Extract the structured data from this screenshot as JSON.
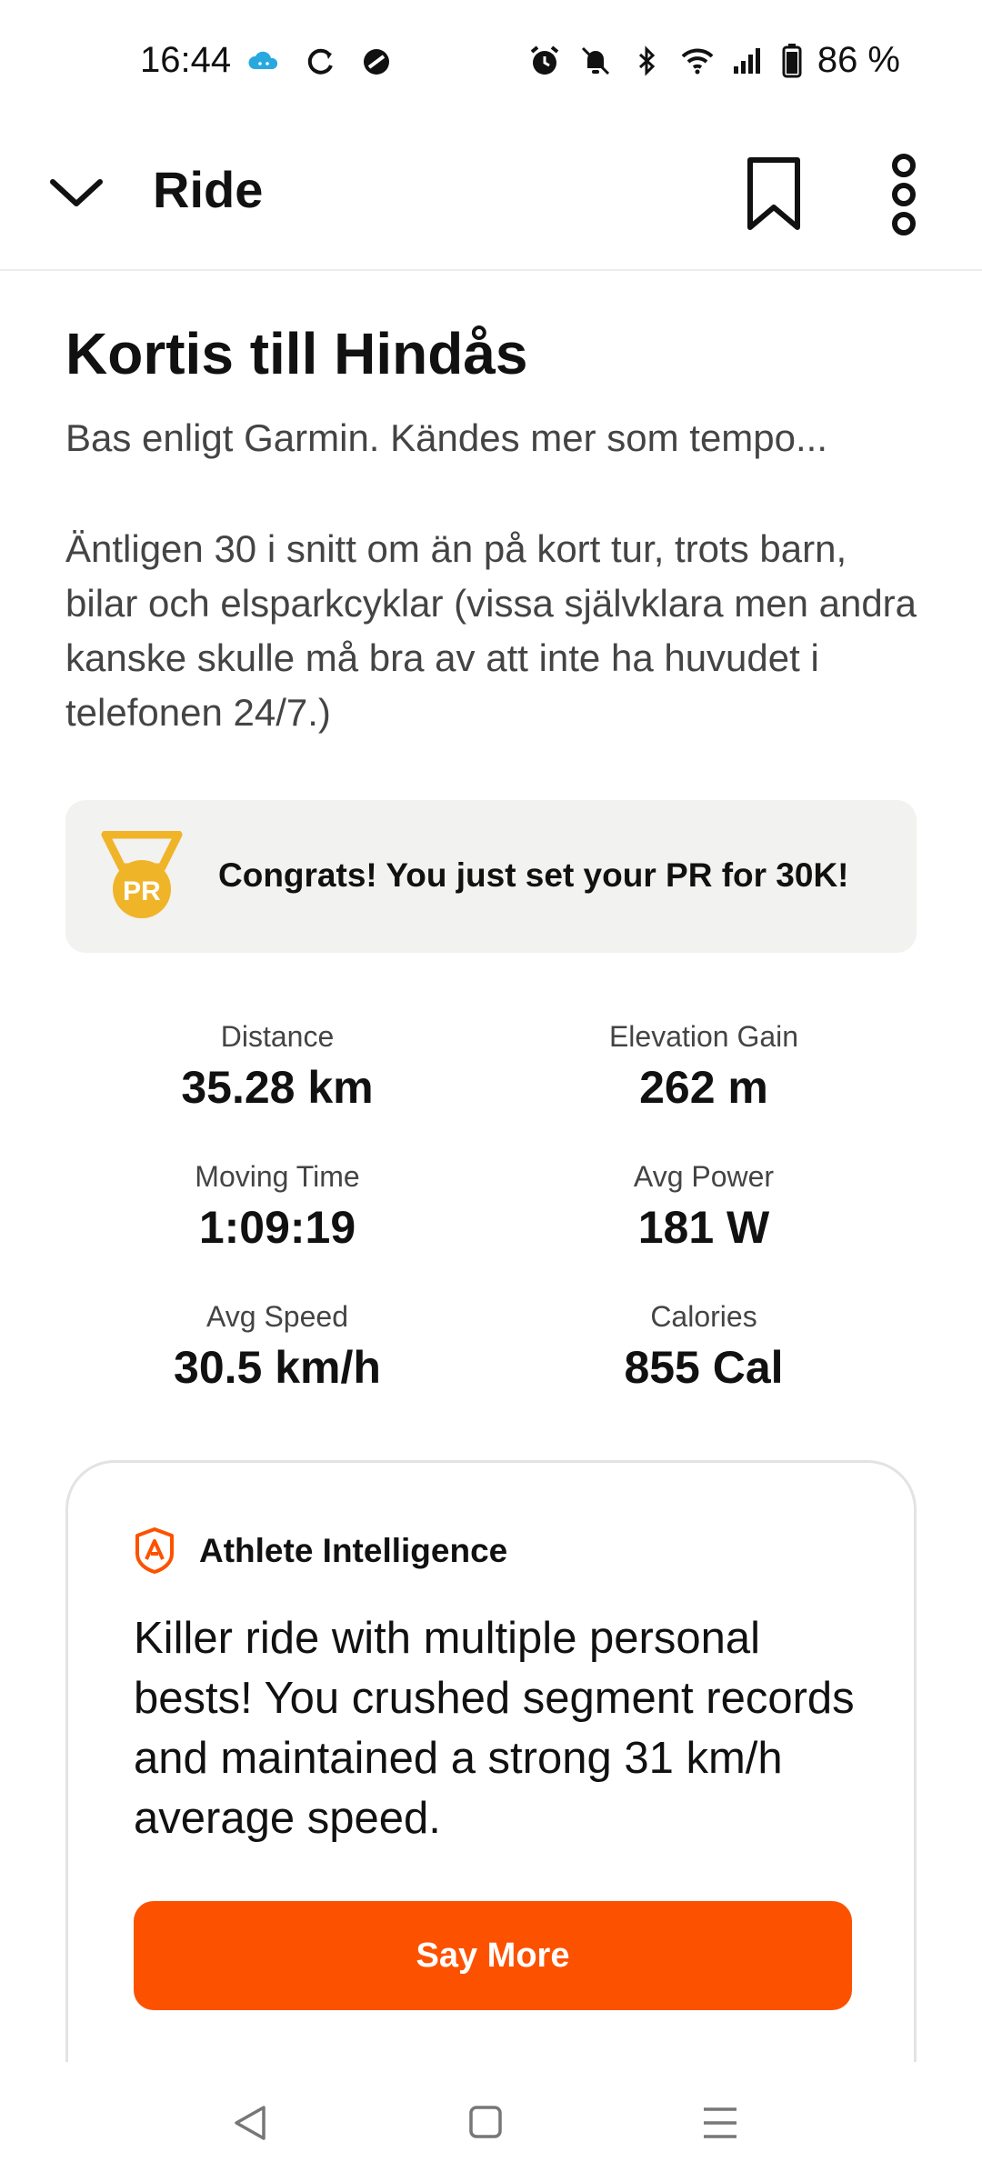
{
  "status_bar": {
    "time": "16:44",
    "battery_text": "86 %",
    "icons_left": [
      "cloud-icon",
      "sync-icon",
      "no-entry-icon"
    ],
    "icons_right": [
      "alarm-icon",
      "bell-off-icon",
      "bluetooth-icon",
      "wifi-icon",
      "signal-icon",
      "battery-icon"
    ]
  },
  "app_bar": {
    "title": "Ride",
    "collapse_icon": "chevron-down-icon",
    "bookmark_icon": "bookmark-icon",
    "more_icon": "more-vertical-icon"
  },
  "activity": {
    "title": "Kortis till Hindås",
    "subtitle": "Bas enligt Garmin. Kändes mer som tempo...",
    "description": "Äntligen 30 i snitt om än på kort tur, trots barn, bilar och elsparkcyklar (vissa självklara men andra kanske skulle må bra av att inte ha huvudet i telefonen 24/7.)"
  },
  "pr_banner": {
    "icon": "pr-medal-icon",
    "medal_text": "PR",
    "text": "Congrats! You just set your PR for 30K!"
  },
  "stats": {
    "distance": {
      "label": "Distance",
      "value": "35.28 km"
    },
    "elevation": {
      "label": "Elevation Gain",
      "value": "262 m"
    },
    "moving_time": {
      "label": "Moving Time",
      "value": "1:09:19"
    },
    "avg_power": {
      "label": "Avg Power",
      "value": "181 W"
    },
    "avg_speed": {
      "label": "Avg Speed",
      "value": "30.5 km/h"
    },
    "calories": {
      "label": "Calories",
      "value": "855 Cal"
    }
  },
  "athlete_intelligence": {
    "icon": "athlete-intelligence-icon",
    "heading": "Athlete Intelligence",
    "body": "Killer ride with multiple personal bests! You crushed segment records and maintained a strong 31 km/h average speed.",
    "button_label": "Say More"
  },
  "nav_bar": {
    "back_icon": "back-triangle-icon",
    "home_icon": "home-square-icon",
    "menu_icon": "menu-lines-icon"
  },
  "colors": {
    "accent": "#fc5200",
    "pr_gold": "#f0b429",
    "card_bg": "#f2f2f0"
  }
}
